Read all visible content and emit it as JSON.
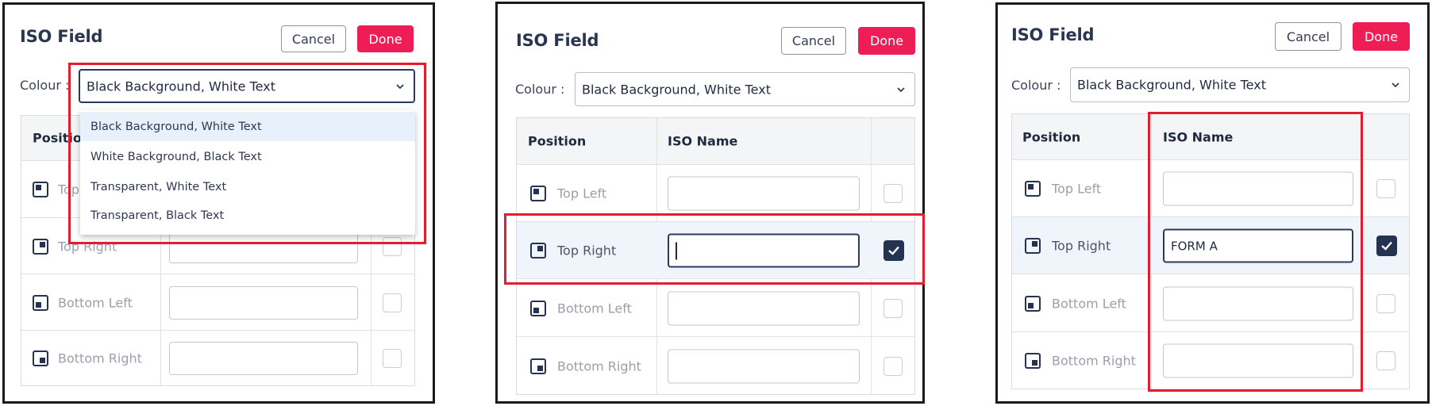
{
  "colors": {
    "accent": "#ee1d55",
    "navy": "#233351",
    "highlight": "#e11d2e"
  },
  "panels": [
    {
      "title": "ISO Field",
      "cancel_label": "Cancel",
      "done_label": "Done",
      "colour_label": "Colour :",
      "colour_value": "Black Background, White Text",
      "dropdown_open": true,
      "dropdown_options": [
        "Black Background, White Text",
        "White Background, Black Text",
        "Transparent, White Text",
        "Transparent, Black Text"
      ],
      "headers": {
        "position": "Position"
      },
      "rows": [
        {
          "label": "Top Left",
          "icon": "top-left-icon",
          "value": "",
          "checked": false
        },
        {
          "label": "Top Right",
          "icon": "top-right-icon",
          "value": "",
          "checked": false
        },
        {
          "label": "Bottom Left",
          "icon": "bottom-left-icon",
          "value": "",
          "checked": false
        },
        {
          "label": "Bottom Right",
          "icon": "bottom-right-icon",
          "value": "",
          "checked": false
        }
      ]
    },
    {
      "title": "ISO Field",
      "cancel_label": "Cancel",
      "done_label": "Done",
      "colour_label": "Colour :",
      "colour_value": "Black Background, White Text",
      "headers": {
        "position": "Position",
        "iso_name": "ISO Name"
      },
      "rows": [
        {
          "label": "Top Left",
          "icon": "top-left-icon",
          "value": "",
          "checked": false
        },
        {
          "label": "Top Right",
          "icon": "top-right-icon",
          "value": "",
          "checked": true
        },
        {
          "label": "Bottom Left",
          "icon": "bottom-left-icon",
          "value": "",
          "checked": false
        },
        {
          "label": "Bottom Right",
          "icon": "bottom-right-icon",
          "value": "",
          "checked": false
        }
      ]
    },
    {
      "title": "ISO Field",
      "cancel_label": "Cancel",
      "done_label": "Done",
      "colour_label": "Colour :",
      "colour_value": "Black Background, White Text",
      "headers": {
        "position": "Position",
        "iso_name": "ISO Name"
      },
      "rows": [
        {
          "label": "Top Left",
          "icon": "top-left-icon",
          "value": "",
          "checked": false
        },
        {
          "label": "Top Right",
          "icon": "top-right-icon",
          "value": "FORM A",
          "checked": true
        },
        {
          "label": "Bottom Left",
          "icon": "bottom-left-icon",
          "value": "",
          "checked": false
        },
        {
          "label": "Bottom Right",
          "icon": "bottom-right-icon",
          "value": "",
          "checked": false
        }
      ]
    }
  ]
}
